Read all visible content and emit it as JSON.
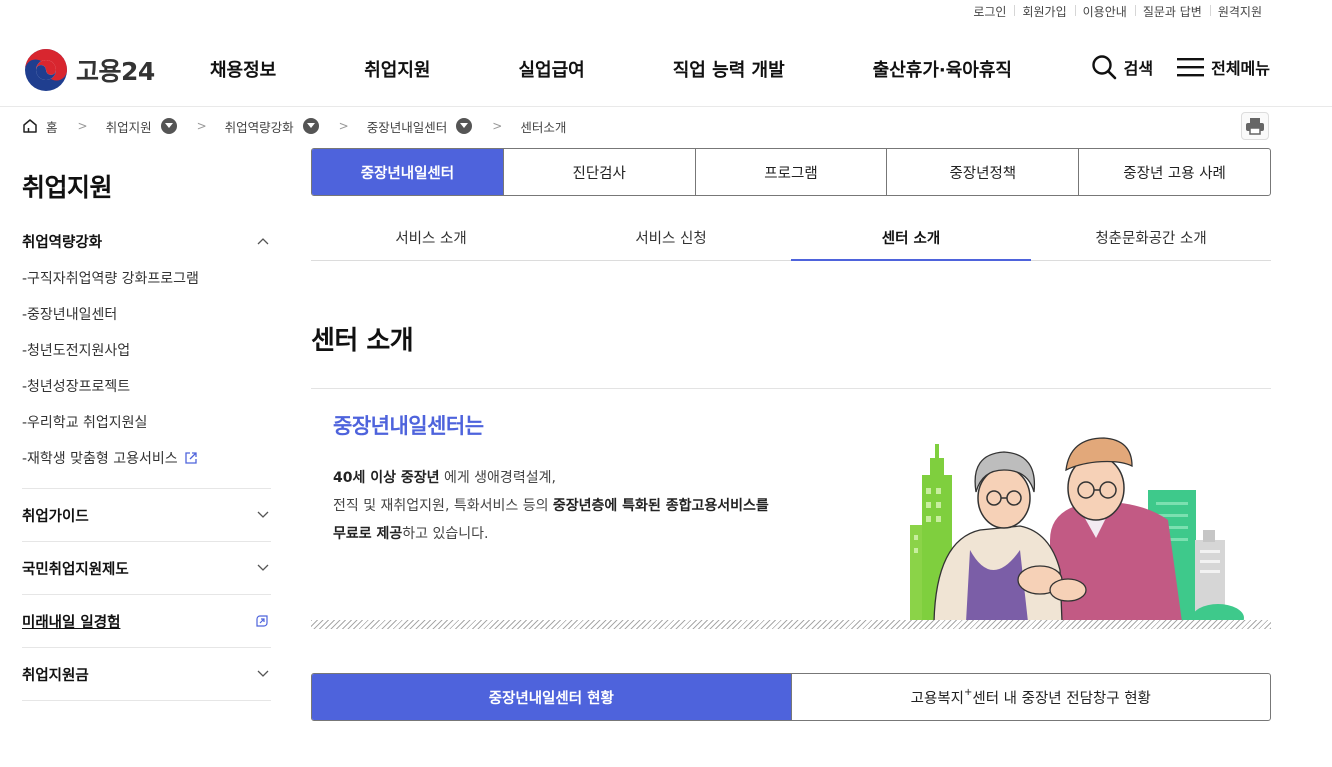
{
  "utility": [
    "로그인",
    "회원가입",
    "이용안내",
    "질문과 답변",
    "원격지원"
  ],
  "logo": {
    "text": "고용24"
  },
  "gnb": [
    "채용정보",
    "취업지원",
    "실업급여",
    "직업 능력 개발",
    "출산휴가·육아휴직"
  ],
  "header_actions": {
    "search": "검색",
    "menu": "전체메뉴"
  },
  "breadcrumb": {
    "home": "홈",
    "items": [
      "취업지원",
      "취업역량강화",
      "중장년내일센터"
    ],
    "current": "센터소개"
  },
  "sidebar": {
    "title": "취업지원",
    "groups": [
      {
        "label": "취업역량강화",
        "expanded": true,
        "items": [
          "-구직자취업역량 강화프로그램",
          "-중장년내일센터",
          "-청년도전지원사업",
          "-청년성장프로젝트",
          "-우리학교 취업지원실",
          "-재학생 맞춤형 고용서비스"
        ]
      },
      {
        "label": "취업가이드"
      },
      {
        "label": "국민취업지원제도"
      },
      {
        "label": "미래내일 일경험"
      },
      {
        "label": "취업지원금"
      }
    ]
  },
  "tabs_primary": [
    "중장년내일센터",
    "진단검사",
    "프로그램",
    "중장년정책",
    "중장년 고용 사례"
  ],
  "tabs_secondary": [
    "서비스 소개",
    "서비스 신청",
    "센터 소개",
    "청춘문화공간 소개"
  ],
  "page_title": "센터 소개",
  "intro": {
    "heading": "중장년내일센터는",
    "line1_bold": "40세 이상 중장년",
    "line1_rest": " 에게 생애경력설계,",
    "line2_a": "전직 및 재취업지원, 특화서비스 등의 ",
    "line2_bold": "중장년층에 특화된 종합고용서비스를",
    "line3_bold": "무료로 제공",
    "line3_rest": "하고 있습니다."
  },
  "tabs_tertiary": {
    "left": "중장년내일센터 현황",
    "right_pre": "고용복지",
    "right_sup": "+",
    "right_post": "센터 내 중장년 전담창구 현황"
  },
  "colors": {
    "accent": "#4e63dc",
    "building_green": "#7fcf3e"
  }
}
